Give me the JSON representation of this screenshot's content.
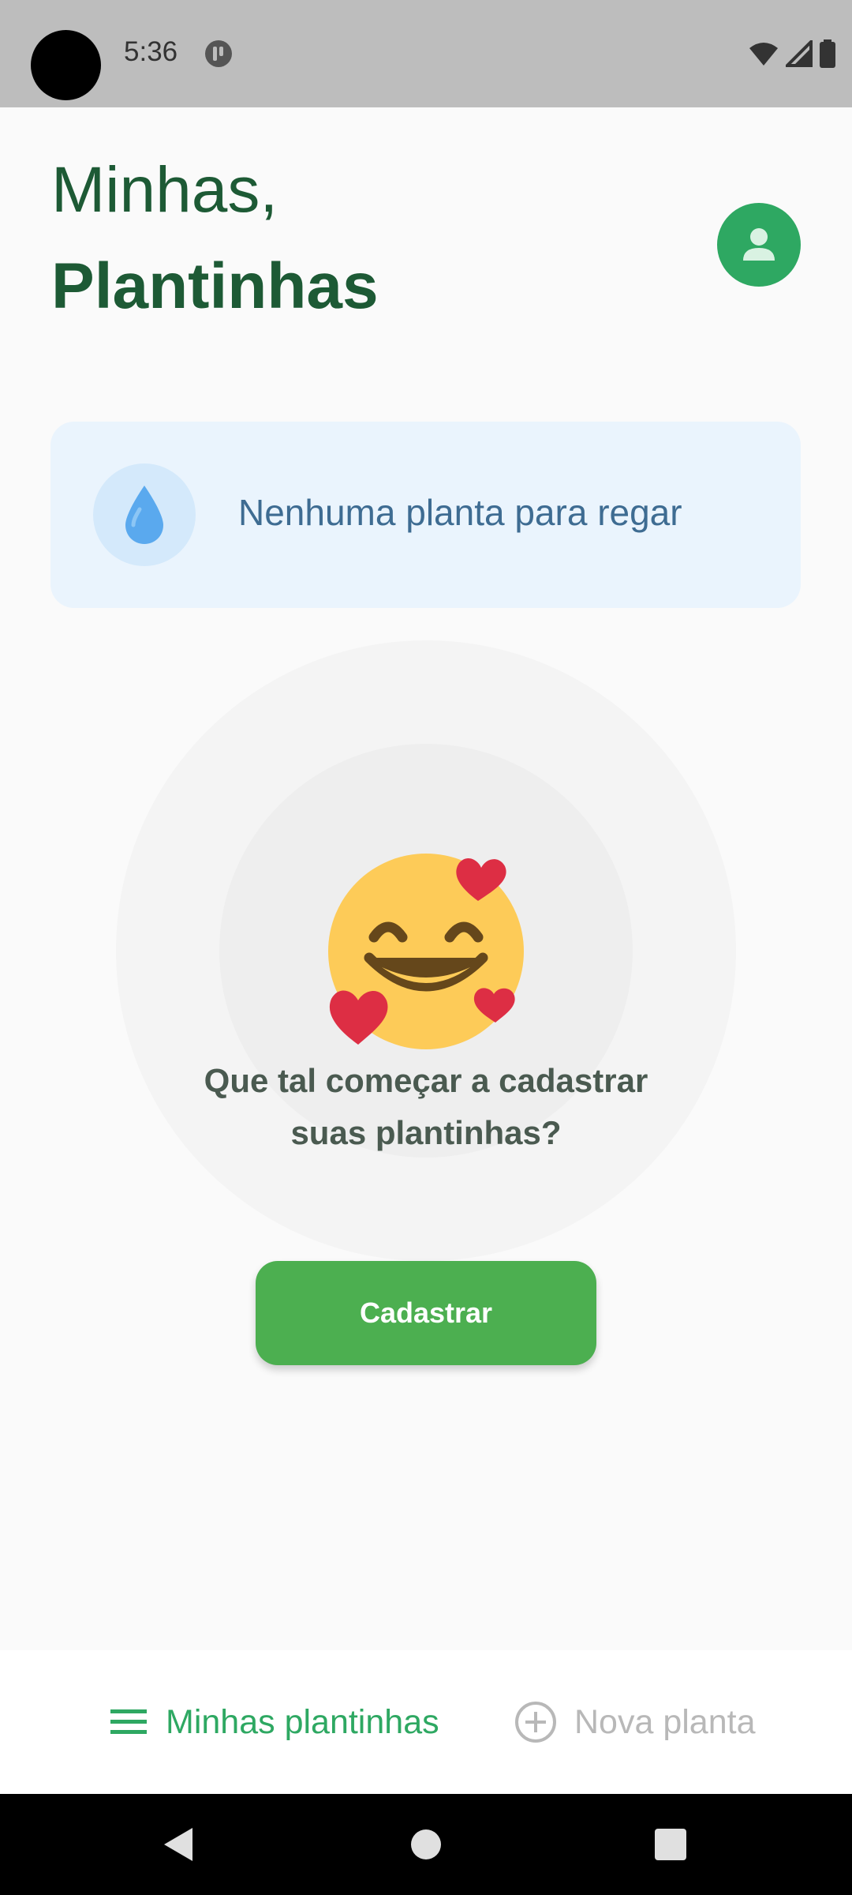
{
  "status_bar": {
    "time": "5:36"
  },
  "header": {
    "greeting": "Minhas,",
    "title": "Plantinhas"
  },
  "icons": {
    "avatar": "user-icon",
    "water": "water-drop-icon",
    "menu": "menu-icon",
    "add": "add-circle-icon",
    "emoji": "smiling-face-with-hearts-icon"
  },
  "water_banner": {
    "text": "Nenhuma planta para regar"
  },
  "empty_state": {
    "line1": "Que tal começar a cadastrar",
    "line2": "suas plantinhas?"
  },
  "cta": {
    "label": "Cadastrar"
  },
  "bottom_nav": {
    "items": [
      {
        "label": "Minhas plantinhas",
        "active": true
      },
      {
        "label": "Nova planta",
        "active": false
      }
    ]
  },
  "colors": {
    "primary_green": "#2ea862",
    "dark_green": "#1d5a35",
    "button_green": "#4caf50",
    "banner_bg": "#eaf4fd",
    "banner_text": "#3e6c92"
  }
}
